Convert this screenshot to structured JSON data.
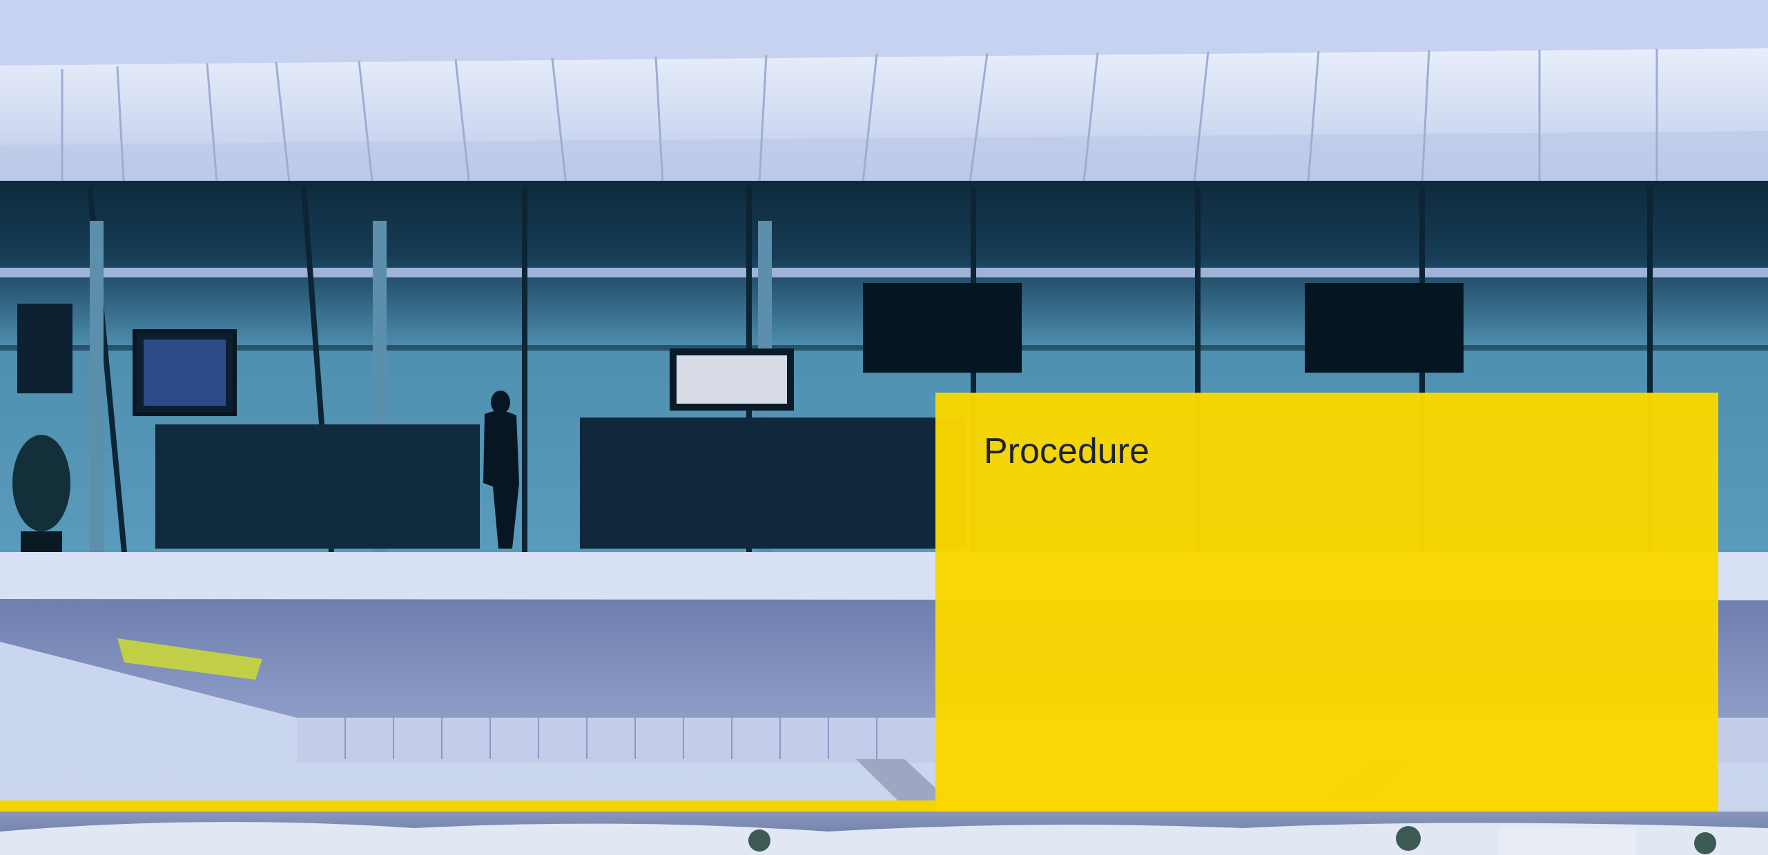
{
  "slide": {
    "title": "Procedure"
  },
  "colors": {
    "accent_yellow": "#f5d400",
    "panel_yellow": "#fad800",
    "title_text": "#1d2233",
    "sky": "#c8d4ef"
  },
  "background": {
    "description_icon": "air-traffic-control-tower-photo"
  }
}
